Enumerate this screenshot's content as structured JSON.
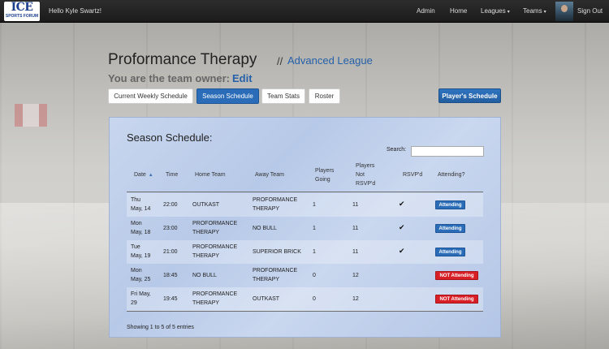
{
  "navbar": {
    "logo_text": "ICE",
    "logo_sub": "SPORTS FORUM",
    "greeting": "Hello Kyle Swartz!",
    "items": [
      {
        "label": "Admin"
      },
      {
        "label": "Home"
      },
      {
        "label": "Leagues",
        "caret": "▾"
      },
      {
        "label": "Teams",
        "caret": "▾"
      }
    ],
    "signout": "Sign Out"
  },
  "header": {
    "team_name": "Proformance Therapy",
    "separator": "//",
    "league": "Advanced League",
    "owner_text": "You are the team owner:",
    "edit_link": "Edit"
  },
  "tabs": [
    {
      "label": "Current Weekly Schedule",
      "active": false
    },
    {
      "label": "Season Schedule",
      "active": true
    },
    {
      "label": "Team Stats",
      "active": false
    },
    {
      "label": "Roster",
      "active": false
    }
  ],
  "players_schedule_button": "Player's Schedule",
  "panel": {
    "title": "Season Schedule:",
    "search_label": "Search:",
    "search_value": "",
    "columns": {
      "date": "Date",
      "sort_indicator": "▲",
      "time": "Time",
      "home": "Home Team",
      "away": "Away Team",
      "going_l1": "Players",
      "going_l2": "Going",
      "notrsvp_l1": "Players",
      "notrsvp_l2": "Not",
      "notrsvp_l3": "RSVP'd",
      "rsvpd": "RSVP'd",
      "attending": "Attending?"
    },
    "rows": [
      {
        "date_l1": "Thu",
        "date_l2": "May, 14",
        "time": "22:00",
        "home_l1": "OUTKAST",
        "home_l2": "",
        "away_l1": "PROFORMANCE",
        "away_l2": "THERAPY",
        "going": "1",
        "not_rsvp": "11",
        "rsvpd": "✔",
        "status": "Attending",
        "status_color": "#2a6cb8"
      },
      {
        "date_l1": "Mon",
        "date_l2": "May, 18",
        "time": "23:00",
        "home_l1": "PROFORMANCE",
        "home_l2": "THERAPY",
        "away_l1": "NO BULL",
        "away_l2": "",
        "going": "1",
        "not_rsvp": "11",
        "rsvpd": "✔",
        "status": "Attending",
        "status_color": "#2a6cb8"
      },
      {
        "date_l1": "Tue",
        "date_l2": "May, 19",
        "time": "21:00",
        "home_l1": "PROFORMANCE",
        "home_l2": "THERAPY",
        "away_l1": "SUPERIOR BRICK",
        "away_l2": "",
        "going": "1",
        "not_rsvp": "11",
        "rsvpd": "✔",
        "status": "Attending",
        "status_color": "#2a6cb8"
      },
      {
        "date_l1": "Mon",
        "date_l2": "May, 25",
        "time": "18:45",
        "home_l1": "NO BULL",
        "home_l2": "",
        "away_l1": "PROFORMANCE",
        "away_l2": "THERAPY",
        "going": "0",
        "not_rsvp": "12",
        "rsvpd": "",
        "status": "NOT Attending",
        "status_color": "#d81f26"
      },
      {
        "date_l1": "Fri May,",
        "date_l2": "29",
        "time": "19:45",
        "home_l1": "PROFORMANCE",
        "home_l2": "THERAPY",
        "away_l1": "OUTKAST",
        "away_l2": "",
        "going": "0",
        "not_rsvp": "12",
        "rsvpd": "",
        "status": "NOT Attending",
        "status_color": "#d81f26"
      }
    ],
    "footer": "Showing 1 to 5 of 5 entries"
  }
}
